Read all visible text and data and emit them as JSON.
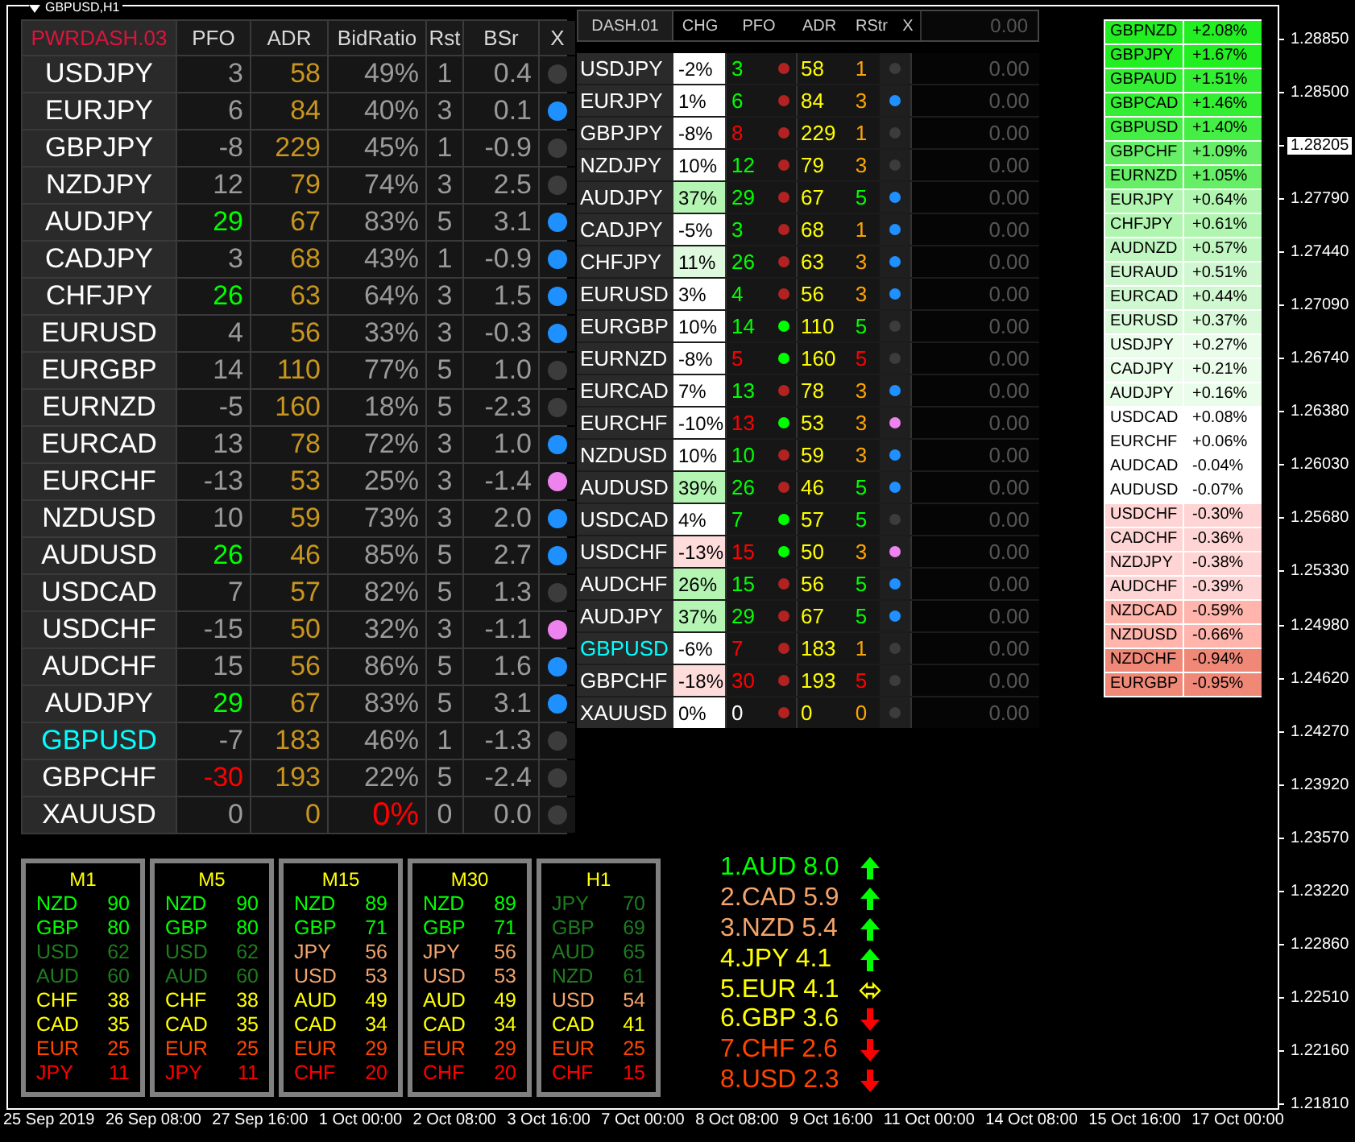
{
  "chart": {
    "title": "GBPUSD,H1",
    "price_axis": [
      {
        "kind": "tick",
        "label": "1.28850"
      },
      {
        "kind": "tick",
        "label": "1.28500"
      },
      {
        "kind": "current",
        "label": "1.28205"
      },
      {
        "kind": "tick",
        "label": "1.27790"
      },
      {
        "kind": "tick",
        "label": "1.27440"
      },
      {
        "kind": "tick",
        "label": "1.27090"
      },
      {
        "kind": "tick",
        "label": "1.26740"
      },
      {
        "kind": "tick",
        "label": "1.26380"
      },
      {
        "kind": "tick",
        "label": "1.26030"
      },
      {
        "kind": "tick",
        "label": "1.25680"
      },
      {
        "kind": "tick",
        "label": "1.25330"
      },
      {
        "kind": "tick",
        "label": "1.24980"
      },
      {
        "kind": "tick",
        "label": "1.24620"
      },
      {
        "kind": "tick",
        "label": "1.24270"
      },
      {
        "kind": "tick",
        "label": "1.23920"
      },
      {
        "kind": "tick",
        "label": "1.23570"
      },
      {
        "kind": "tick",
        "label": "1.23220"
      },
      {
        "kind": "tick",
        "label": "1.22860"
      },
      {
        "kind": "tick",
        "label": "1.22510"
      },
      {
        "kind": "tick",
        "label": "1.22160"
      },
      {
        "kind": "tick",
        "label": "1.21810"
      }
    ],
    "time_axis": [
      "25 Sep 2019",
      "26 Sep 08:00",
      "27 Sep 16:00",
      "1 Oct 00:00",
      "2 Oct 08:00",
      "3 Oct 16:00",
      "7 Oct 00:00",
      "8 Oct 08:00",
      "9 Oct 16:00",
      "11 Oct 00:00",
      "14 Oct 08:00",
      "15 Oct 16:00",
      "17 Oct 00:00"
    ]
  },
  "pwrdash": {
    "title": "PWRDASH.03",
    "columns": [
      "PFO",
      "ADR",
      "BidRatio",
      "Rst",
      "BSr",
      "X"
    ],
    "rows": [
      {
        "symbol": {
          "text": "USDJPY",
          "kind": "plain"
        },
        "pfo": {
          "text": "3",
          "kind": "neutral"
        },
        "adr": "58",
        "bid_ratio": {
          "text": "49%",
          "kind": "plain"
        },
        "rst": "1",
        "bsr": "0.4",
        "color": "#3c3c3c"
      },
      {
        "symbol": {
          "text": "EURJPY",
          "kind": "plain"
        },
        "pfo": {
          "text": "6",
          "kind": "neutral"
        },
        "adr": "84",
        "bid_ratio": {
          "text": "40%",
          "kind": "plain"
        },
        "rst": "3",
        "bsr": "0.1",
        "color": "#1e90ff"
      },
      {
        "symbol": {
          "text": "GBPJPY",
          "kind": "plain"
        },
        "pfo": {
          "text": "-8",
          "kind": "neutral"
        },
        "adr": "229",
        "bid_ratio": {
          "text": "45%",
          "kind": "plain"
        },
        "rst": "1",
        "bsr": "-0.9",
        "color": "#3c3c3c"
      },
      {
        "symbol": {
          "text": "NZDJPY",
          "kind": "plain"
        },
        "pfo": {
          "text": "12",
          "kind": "neutral"
        },
        "adr": "79",
        "bid_ratio": {
          "text": "74%",
          "kind": "plain"
        },
        "rst": "3",
        "bsr": "2.5",
        "color": "#3c3c3c"
      },
      {
        "symbol": {
          "text": "AUDJPY",
          "kind": "plain"
        },
        "pfo": {
          "text": "29",
          "kind": "positive"
        },
        "adr": "67",
        "bid_ratio": {
          "text": "83%",
          "kind": "plain"
        },
        "rst": "5",
        "bsr": "3.1",
        "color": "#1e90ff"
      },
      {
        "symbol": {
          "text": "CADJPY",
          "kind": "plain"
        },
        "pfo": {
          "text": "3",
          "kind": "neutral"
        },
        "adr": "68",
        "bid_ratio": {
          "text": "43%",
          "kind": "plain"
        },
        "rst": "1",
        "bsr": "-0.9",
        "color": "#1e90ff"
      },
      {
        "symbol": {
          "text": "CHFJPY",
          "kind": "plain"
        },
        "pfo": {
          "text": "26",
          "kind": "positive"
        },
        "adr": "63",
        "bid_ratio": {
          "text": "64%",
          "kind": "plain"
        },
        "rst": "3",
        "bsr": "1.5",
        "color": "#1e90ff"
      },
      {
        "symbol": {
          "text": "EURUSD",
          "kind": "plain"
        },
        "pfo": {
          "text": "4",
          "kind": "neutral"
        },
        "adr": "56",
        "bid_ratio": {
          "text": "33%",
          "kind": "plain"
        },
        "rst": "3",
        "bsr": "-0.3",
        "color": "#1e90ff"
      },
      {
        "symbol": {
          "text": "EURGBP",
          "kind": "plain"
        },
        "pfo": {
          "text": "14",
          "kind": "neutral"
        },
        "adr": "110",
        "bid_ratio": {
          "text": "77%",
          "kind": "plain"
        },
        "rst": "5",
        "bsr": "1.0",
        "color": "#3c3c3c"
      },
      {
        "symbol": {
          "text": "EURNZD",
          "kind": "plain"
        },
        "pfo": {
          "text": "-5",
          "kind": "neutral"
        },
        "adr": "160",
        "bid_ratio": {
          "text": "18%",
          "kind": "plain"
        },
        "rst": "5",
        "bsr": "-2.3",
        "color": "#3c3c3c"
      },
      {
        "symbol": {
          "text": "EURCAD",
          "kind": "plain"
        },
        "pfo": {
          "text": "13",
          "kind": "neutral"
        },
        "adr": "78",
        "bid_ratio": {
          "text": "72%",
          "kind": "plain"
        },
        "rst": "3",
        "bsr": "1.0",
        "color": "#1e90ff"
      },
      {
        "symbol": {
          "text": "EURCHF",
          "kind": "plain"
        },
        "pfo": {
          "text": "-13",
          "kind": "neutral"
        },
        "adr": "53",
        "bid_ratio": {
          "text": "25%",
          "kind": "plain"
        },
        "rst": "3",
        "bsr": "-1.4",
        "color": "#ee82ee"
      },
      {
        "symbol": {
          "text": "NZDUSD",
          "kind": "plain"
        },
        "pfo": {
          "text": "10",
          "kind": "neutral"
        },
        "adr": "59",
        "bid_ratio": {
          "text": "73%",
          "kind": "plain"
        },
        "rst": "3",
        "bsr": "2.0",
        "color": "#1e90ff"
      },
      {
        "symbol": {
          "text": "AUDUSD",
          "kind": "plain"
        },
        "pfo": {
          "text": "26",
          "kind": "positive"
        },
        "adr": "46",
        "bid_ratio": {
          "text": "85%",
          "kind": "plain"
        },
        "rst": "5",
        "bsr": "2.7",
        "color": "#1e90ff"
      },
      {
        "symbol": {
          "text": "USDCAD",
          "kind": "plain"
        },
        "pfo": {
          "text": "7",
          "kind": "neutral"
        },
        "adr": "57",
        "bid_ratio": {
          "text": "82%",
          "kind": "plain"
        },
        "rst": "5",
        "bsr": "1.3",
        "color": "#3c3c3c"
      },
      {
        "symbol": {
          "text": "USDCHF",
          "kind": "plain"
        },
        "pfo": {
          "text": "-15",
          "kind": "neutral"
        },
        "adr": "50",
        "bid_ratio": {
          "text": "32%",
          "kind": "plain"
        },
        "rst": "3",
        "bsr": "-1.1",
        "color": "#ee82ee"
      },
      {
        "symbol": {
          "text": "AUDCHF",
          "kind": "plain"
        },
        "pfo": {
          "text": "15",
          "kind": "neutral"
        },
        "adr": "56",
        "bid_ratio": {
          "text": "86%",
          "kind": "plain"
        },
        "rst": "5",
        "bsr": "1.6",
        "color": "#1e90ff"
      },
      {
        "symbol": {
          "text": "AUDJPY",
          "kind": "plain"
        },
        "pfo": {
          "text": "29",
          "kind": "positive"
        },
        "adr": "67",
        "bid_ratio": {
          "text": "83%",
          "kind": "plain"
        },
        "rst": "5",
        "bsr": "3.1",
        "color": "#1e90ff"
      },
      {
        "symbol": {
          "text": "GBPUSD",
          "kind": "current"
        },
        "pfo": {
          "text": "-7",
          "kind": "neutral"
        },
        "adr": "183",
        "bid_ratio": {
          "text": "46%",
          "kind": "plain"
        },
        "rst": "1",
        "bsr": "-1.3",
        "color": "#3c3c3c"
      },
      {
        "symbol": {
          "text": "GBPCHF",
          "kind": "plain"
        },
        "pfo": {
          "text": "-30",
          "kind": "negative"
        },
        "adr": "193",
        "bid_ratio": {
          "text": "22%",
          "kind": "plain"
        },
        "rst": "5",
        "bsr": "-2.4",
        "color": "#3c3c3c"
      },
      {
        "symbol": {
          "text": "XAUUSD",
          "kind": "plain"
        },
        "pfo": {
          "text": "0",
          "kind": "neutral"
        },
        "adr": "0",
        "bid_ratio": {
          "text": "0%",
          "kind": "alert"
        },
        "rst": "0",
        "bsr": "0.0",
        "color": "#3c3c3c"
      }
    ]
  },
  "dash": {
    "title": "DASH.01",
    "columns": [
      "CHG",
      "PFO",
      "ADR",
      "RStr",
      "X"
    ],
    "total": "0.00",
    "rows": [
      {
        "symbol": {
          "text": "USDJPY",
          "kind": "plain"
        },
        "chg": {
          "text": "-2%",
          "color": "#ffffff"
        },
        "pfo": {
          "text": "3",
          "kind": "positive"
        },
        "pfo_dot": {
          "color": "#b22222"
        },
        "adr": "58",
        "rstr": {
          "text": "1",
          "kind": "neutral"
        },
        "color": "#3c3c3c",
        "value": "0.00"
      },
      {
        "symbol": {
          "text": "EURJPY",
          "kind": "plain"
        },
        "chg": {
          "text": "1%",
          "color": "#ffffff"
        },
        "pfo": {
          "text": "6",
          "kind": "positive"
        },
        "pfo_dot": {
          "color": "#b22222"
        },
        "adr": "84",
        "rstr": {
          "text": "3",
          "kind": "neutral"
        },
        "color": "#1e90ff",
        "value": "0.00"
      },
      {
        "symbol": {
          "text": "GBPJPY",
          "kind": "plain"
        },
        "chg": {
          "text": "-8%",
          "color": "#ffffff"
        },
        "pfo": {
          "text": "8",
          "kind": "negative"
        },
        "pfo_dot": {
          "color": "#b22222"
        },
        "adr": "229",
        "rstr": {
          "text": "1",
          "kind": "neutral"
        },
        "color": "#3c3c3c",
        "value": "0.00"
      },
      {
        "symbol": {
          "text": "NZDJPY",
          "kind": "plain"
        },
        "chg": {
          "text": "10%",
          "color": "#ffffff"
        },
        "pfo": {
          "text": "12",
          "kind": "positive"
        },
        "pfo_dot": {
          "color": "#b22222"
        },
        "adr": "79",
        "rstr": {
          "text": "3",
          "kind": "neutral"
        },
        "color": "#3c3c3c",
        "value": "0.00"
      },
      {
        "symbol": {
          "text": "AUDJPY",
          "kind": "plain"
        },
        "chg": {
          "text": "37%",
          "color": "#b4f5b4"
        },
        "pfo": {
          "text": "29",
          "kind": "positive"
        },
        "pfo_dot": {
          "color": "#b22222"
        },
        "adr": "67",
        "rstr": {
          "text": "5",
          "kind": "positive"
        },
        "color": "#1e90ff",
        "value": "0.00"
      },
      {
        "symbol": {
          "text": "CADJPY",
          "kind": "plain"
        },
        "chg": {
          "text": "-5%",
          "color": "#ffffff"
        },
        "pfo": {
          "text": "3",
          "kind": "positive"
        },
        "pfo_dot": {
          "color": "#b22222"
        },
        "adr": "68",
        "rstr": {
          "text": "1",
          "kind": "neutral"
        },
        "color": "#1e90ff",
        "value": "0.00"
      },
      {
        "symbol": {
          "text": "CHFJPY",
          "kind": "plain"
        },
        "chg": {
          "text": "11%",
          "color": "#def9de"
        },
        "pfo": {
          "text": "26",
          "kind": "positive"
        },
        "pfo_dot": {
          "color": "#b22222"
        },
        "adr": "63",
        "rstr": {
          "text": "3",
          "kind": "neutral"
        },
        "color": "#1e90ff",
        "value": "0.00"
      },
      {
        "symbol": {
          "text": "EURUSD",
          "kind": "plain"
        },
        "chg": {
          "text": "3%",
          "color": "#ffffff"
        },
        "pfo": {
          "text": "4",
          "kind": "positive"
        },
        "pfo_dot": {
          "color": "#b22222"
        },
        "adr": "56",
        "rstr": {
          "text": "3",
          "kind": "neutral"
        },
        "color": "#1e90ff",
        "value": "0.00"
      },
      {
        "symbol": {
          "text": "EURGBP",
          "kind": "plain"
        },
        "chg": {
          "text": "10%",
          "color": "#ffffff"
        },
        "pfo": {
          "text": "14",
          "kind": "positive"
        },
        "pfo_dot": {
          "color": "#00ff00"
        },
        "adr": "110",
        "rstr": {
          "text": "5",
          "kind": "positive"
        },
        "color": "#3c3c3c",
        "value": "0.00"
      },
      {
        "symbol": {
          "text": "EURNZD",
          "kind": "plain"
        },
        "chg": {
          "text": "-8%",
          "color": "#ffffff"
        },
        "pfo": {
          "text": "5",
          "kind": "negative"
        },
        "pfo_dot": {
          "color": "#00ff00"
        },
        "adr": "160",
        "rstr": {
          "text": "5",
          "kind": "negative"
        },
        "color": "#3c3c3c",
        "value": "0.00"
      },
      {
        "symbol": {
          "text": "EURCAD",
          "kind": "plain"
        },
        "chg": {
          "text": "7%",
          "color": "#ffffff"
        },
        "pfo": {
          "text": "13",
          "kind": "positive"
        },
        "pfo_dot": {
          "color": "#b22222"
        },
        "adr": "78",
        "rstr": {
          "text": "3",
          "kind": "neutral"
        },
        "color": "#1e90ff",
        "value": "0.00"
      },
      {
        "symbol": {
          "text": "EURCHF",
          "kind": "plain"
        },
        "chg": {
          "text": "-10%",
          "color": "#ffffff"
        },
        "pfo": {
          "text": "13",
          "kind": "negative"
        },
        "pfo_dot": {
          "color": "#00ff00"
        },
        "adr": "53",
        "rstr": {
          "text": "3",
          "kind": "neutral"
        },
        "color": "#ee82ee",
        "value": "0.00"
      },
      {
        "symbol": {
          "text": "NZDUSD",
          "kind": "plain"
        },
        "chg": {
          "text": "10%",
          "color": "#ffffff"
        },
        "pfo": {
          "text": "10",
          "kind": "positive"
        },
        "pfo_dot": {
          "color": "#b22222"
        },
        "adr": "59",
        "rstr": {
          "text": "3",
          "kind": "neutral"
        },
        "color": "#1e90ff",
        "value": "0.00"
      },
      {
        "symbol": {
          "text": "AUDUSD",
          "kind": "plain"
        },
        "chg": {
          "text": "39%",
          "color": "#b4f5b4"
        },
        "pfo": {
          "text": "26",
          "kind": "positive"
        },
        "pfo_dot": {
          "color": "#b22222"
        },
        "adr": "46",
        "rstr": {
          "text": "5",
          "kind": "positive"
        },
        "color": "#1e90ff",
        "value": "0.00"
      },
      {
        "symbol": {
          "text": "USDCAD",
          "kind": "plain"
        },
        "chg": {
          "text": "4%",
          "color": "#ffffff"
        },
        "pfo": {
          "text": "7",
          "kind": "positive"
        },
        "pfo_dot": {
          "color": "#00ff00"
        },
        "adr": "57",
        "rstr": {
          "text": "5",
          "kind": "positive"
        },
        "color": "#3c3c3c",
        "value": "0.00"
      },
      {
        "symbol": {
          "text": "USDCHF",
          "kind": "plain"
        },
        "chg": {
          "text": "-13%",
          "color": "#ffdcdc"
        },
        "pfo": {
          "text": "15",
          "kind": "negative"
        },
        "pfo_dot": {
          "color": "#00ff00"
        },
        "adr": "50",
        "rstr": {
          "text": "3",
          "kind": "neutral"
        },
        "color": "#ee82ee",
        "value": "0.00"
      },
      {
        "symbol": {
          "text": "AUDCHF",
          "kind": "plain"
        },
        "chg": {
          "text": "26%",
          "color": "#b4f5b4"
        },
        "pfo": {
          "text": "15",
          "kind": "positive"
        },
        "pfo_dot": {
          "color": "#b22222"
        },
        "adr": "56",
        "rstr": {
          "text": "5",
          "kind": "positive"
        },
        "color": "#1e90ff",
        "value": "0.00"
      },
      {
        "symbol": {
          "text": "AUDJPY",
          "kind": "plain"
        },
        "chg": {
          "text": "37%",
          "color": "#b4f5b4"
        },
        "pfo": {
          "text": "29",
          "kind": "positive"
        },
        "pfo_dot": {
          "color": "#b22222"
        },
        "adr": "67",
        "rstr": {
          "text": "5",
          "kind": "positive"
        },
        "color": "#1e90ff",
        "value": "0.00"
      },
      {
        "symbol": {
          "text": "GBPUSD",
          "kind": "current"
        },
        "chg": {
          "text": "-6%",
          "color": "#ffffff"
        },
        "pfo": {
          "text": "7",
          "kind": "negative"
        },
        "pfo_dot": {
          "color": "#b22222"
        },
        "adr": "183",
        "rstr": {
          "text": "1",
          "kind": "neutral"
        },
        "color": "#3c3c3c",
        "value": "0.00"
      },
      {
        "symbol": {
          "text": "GBPCHF",
          "kind": "plain"
        },
        "chg": {
          "text": "-18%",
          "color": "#ffdcdc"
        },
        "pfo": {
          "text": "30",
          "kind": "negative"
        },
        "pfo_dot": {
          "color": "#b22222"
        },
        "adr": "193",
        "rstr": {
          "text": "5",
          "kind": "negative"
        },
        "color": "#3c3c3c",
        "value": "0.00"
      },
      {
        "symbol": {
          "text": "XAUUSD",
          "kind": "plain"
        },
        "chg": {
          "text": "0%",
          "color": "#ffffff"
        },
        "pfo": {
          "text": "0",
          "kind": "neutral"
        },
        "pfo_dot": {
          "color": "#b22222"
        },
        "adr": "0",
        "rstr": {
          "text": "0",
          "kind": "neutral"
        },
        "color": "#3c3c3c",
        "value": "0.00"
      }
    ]
  },
  "changes": [
    {
      "pair": "GBPNZD",
      "change": "+2.08%",
      "color": "#22ee22"
    },
    {
      "pair": "GBPJPY",
      "change": "+1.67%",
      "color": "#22ee22"
    },
    {
      "pair": "GBPAUD",
      "change": "+1.51%",
      "color": "#33ee33"
    },
    {
      "pair": "GBPCAD",
      "change": "+1.46%",
      "color": "#33ee33"
    },
    {
      "pair": "GBPUSD",
      "change": "+1.40%",
      "color": "#44ee44"
    },
    {
      "pair": "GBPCHF",
      "change": "+1.09%",
      "color": "#66ee66"
    },
    {
      "pair": "EURNZD",
      "change": "+1.05%",
      "color": "#66ee66"
    },
    {
      "pair": "EURJPY",
      "change": "+0.64%",
      "color": "#b0f5b0"
    },
    {
      "pair": "CHFJPY",
      "change": "+0.61%",
      "color": "#b0f5b0"
    },
    {
      "pair": "AUDNZD",
      "change": "+0.57%",
      "color": "#c0f7c0"
    },
    {
      "pair": "EURAUD",
      "change": "+0.51%",
      "color": "#d0f8d0"
    },
    {
      "pair": "EURCAD",
      "change": "+0.44%",
      "color": "#d0f8d0"
    },
    {
      "pair": "EURUSD",
      "change": "+0.37%",
      "color": "#d8fad8"
    },
    {
      "pair": "USDJPY",
      "change": "+0.27%",
      "color": "#eafcea"
    },
    {
      "pair": "CADJPY",
      "change": "+0.21%",
      "color": "#eafcea"
    },
    {
      "pair": "AUDJPY",
      "change": "+0.16%",
      "color": "#eafcea"
    },
    {
      "pair": "USDCAD",
      "change": "+0.08%",
      "color": "#ffffff"
    },
    {
      "pair": "EURCHF",
      "change": "+0.06%",
      "color": "#ffffff"
    },
    {
      "pair": "AUDCAD",
      "change": "-0.04%",
      "color": "#ffffff"
    },
    {
      "pair": "AUDUSD",
      "change": "-0.07%",
      "color": "#ffffff"
    },
    {
      "pair": "USDCHF",
      "change": "-0.30%",
      "color": "#ffd4d4"
    },
    {
      "pair": "CADCHF",
      "change": "-0.36%",
      "color": "#ffd4d4"
    },
    {
      "pair": "NZDJPY",
      "change": "-0.38%",
      "color": "#ffd4d4"
    },
    {
      "pair": "AUDCHF",
      "change": "-0.39%",
      "color": "#ffd4d4"
    },
    {
      "pair": "NZDCAD",
      "change": "-0.59%",
      "color": "#ffb4ac"
    },
    {
      "pair": "NZDUSD",
      "change": "-0.66%",
      "color": "#ffb4ac"
    },
    {
      "pair": "NZDCHF",
      "change": "-0.94%",
      "color": "#f08878"
    },
    {
      "pair": "EURGBP",
      "change": "-0.95%",
      "color": "#f08878"
    }
  ],
  "timeframes": [
    {
      "title": "M1",
      "items": [
        {
          "currency": "NZD",
          "value": "90",
          "kind": "strong"
        },
        {
          "currency": "GBP",
          "value": "80",
          "kind": "strong"
        },
        {
          "currency": "USD",
          "value": "62",
          "kind": "firm"
        },
        {
          "currency": "AUD",
          "value": "60",
          "kind": "firm"
        },
        {
          "currency": "CHF",
          "value": "38",
          "kind": "weak"
        },
        {
          "currency": "CAD",
          "value": "35",
          "kind": "weak"
        },
        {
          "currency": "EUR",
          "value": "25",
          "kind": "weaker"
        },
        {
          "currency": "JPY",
          "value": "11",
          "kind": "weakest"
        }
      ]
    },
    {
      "title": "M5",
      "items": [
        {
          "currency": "NZD",
          "value": "90",
          "kind": "strong"
        },
        {
          "currency": "GBP",
          "value": "80",
          "kind": "strong"
        },
        {
          "currency": "USD",
          "value": "62",
          "kind": "firm"
        },
        {
          "currency": "AUD",
          "value": "60",
          "kind": "firm"
        },
        {
          "currency": "CHF",
          "value": "38",
          "kind": "weak"
        },
        {
          "currency": "CAD",
          "value": "35",
          "kind": "weak"
        },
        {
          "currency": "EUR",
          "value": "25",
          "kind": "weaker"
        },
        {
          "currency": "JPY",
          "value": "11",
          "kind": "weakest"
        }
      ]
    },
    {
      "title": "M15",
      "items": [
        {
          "currency": "NZD",
          "value": "89",
          "kind": "strong"
        },
        {
          "currency": "GBP",
          "value": "71",
          "kind": "strong"
        },
        {
          "currency": "JPY",
          "value": "56",
          "kind": "mild"
        },
        {
          "currency": "USD",
          "value": "53",
          "kind": "mild"
        },
        {
          "currency": "AUD",
          "value": "49",
          "kind": "weak"
        },
        {
          "currency": "CAD",
          "value": "34",
          "kind": "weak"
        },
        {
          "currency": "EUR",
          "value": "29",
          "kind": "weaker"
        },
        {
          "currency": "CHF",
          "value": "20",
          "kind": "weakest"
        }
      ]
    },
    {
      "title": "M30",
      "items": [
        {
          "currency": "NZD",
          "value": "89",
          "kind": "strong"
        },
        {
          "currency": "GBP",
          "value": "71",
          "kind": "strong"
        },
        {
          "currency": "JPY",
          "value": "56",
          "kind": "mild"
        },
        {
          "currency": "USD",
          "value": "53",
          "kind": "mild"
        },
        {
          "currency": "AUD",
          "value": "49",
          "kind": "weak"
        },
        {
          "currency": "CAD",
          "value": "34",
          "kind": "weak"
        },
        {
          "currency": "EUR",
          "value": "29",
          "kind": "weaker"
        },
        {
          "currency": "CHF",
          "value": "20",
          "kind": "weakest"
        }
      ]
    },
    {
      "title": "H1",
      "items": [
        {
          "currency": "JPY",
          "value": "70",
          "kind": "firm"
        },
        {
          "currency": "GBP",
          "value": "69",
          "kind": "firm"
        },
        {
          "currency": "AUD",
          "value": "65",
          "kind": "firm"
        },
        {
          "currency": "NZD",
          "value": "61",
          "kind": "firm"
        },
        {
          "currency": "USD",
          "value": "54",
          "kind": "mild"
        },
        {
          "currency": "CAD",
          "value": "41",
          "kind": "weak"
        },
        {
          "currency": "EUR",
          "value": "25",
          "kind": "weaker"
        },
        {
          "currency": "CHF",
          "value": "15",
          "kind": "weakest"
        }
      ]
    }
  ],
  "strength": [
    {
      "rank": "1.",
      "currency": "AUD",
      "value": "8.0",
      "kind": "strong",
      "arrow": {
        "kind": "up"
      }
    },
    {
      "rank": "2.",
      "currency": "CAD",
      "value": "5.9",
      "kind": "mild",
      "arrow": {
        "kind": "up"
      }
    },
    {
      "rank": "3.",
      "currency": "NZD",
      "value": "5.4",
      "kind": "mild",
      "arrow": {
        "kind": "up"
      }
    },
    {
      "rank": "4.",
      "currency": "JPY",
      "value": "4.1",
      "kind": "weak",
      "arrow": {
        "kind": "up"
      }
    },
    {
      "rank": "5.",
      "currency": "EUR",
      "value": "4.1",
      "kind": "weak",
      "arrow": {
        "kind": "flat"
      }
    },
    {
      "rank": "6.",
      "currency": "GBP",
      "value": "3.6",
      "kind": "weak",
      "arrow": {
        "kind": "down"
      }
    },
    {
      "rank": "7.",
      "currency": "CHF",
      "value": "2.6",
      "kind": "weaker",
      "arrow": {
        "kind": "down"
      }
    },
    {
      "rank": "8.",
      "currency": "USD",
      "value": "2.3",
      "kind": "weaker",
      "arrow": {
        "kind": "down"
      }
    }
  ]
}
